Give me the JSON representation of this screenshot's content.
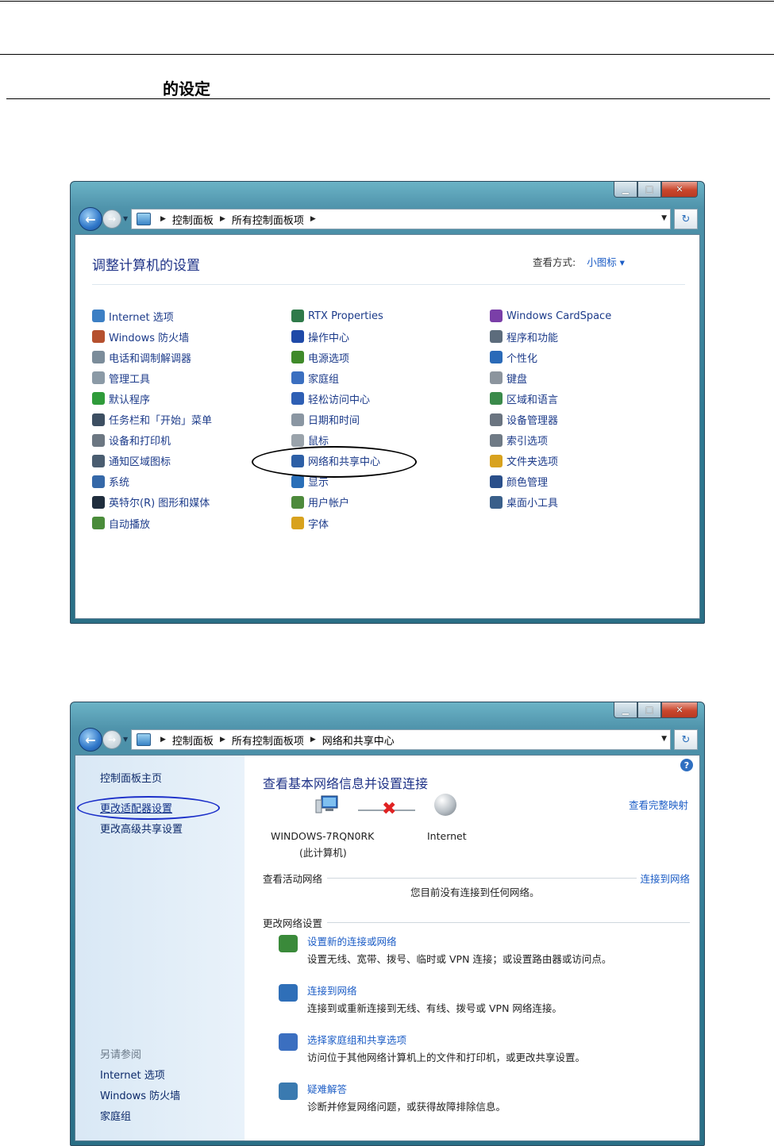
{
  "document": {
    "section_title": "的设定"
  },
  "window1": {
    "breadcrumb": [
      "控制面板",
      "所有控制面板项"
    ],
    "title": "调整计算机的设置",
    "view_by_label": "查看方式:",
    "view_by_value": "小图标 ▾",
    "columns": [
      [
        {
          "label": "Internet 选项",
          "icon": "internet-options-icon",
          "color": "#3c7fc4"
        },
        {
          "label": "Windows 防火墙",
          "icon": "firewall-icon",
          "color": "#b5502e"
        },
        {
          "label": "电话和调制解调器",
          "icon": "phone-modem-icon",
          "color": "#7b8c9a"
        },
        {
          "label": "管理工具",
          "icon": "admin-tools-icon",
          "color": "#8b9aa6"
        },
        {
          "label": "默认程序",
          "icon": "default-programs-icon",
          "color": "#2f9b3a"
        },
        {
          "label": "任务栏和「开始」菜单",
          "icon": "taskbar-icon",
          "color": "#3d4f62"
        },
        {
          "label": "设备和打印机",
          "icon": "printer-icon",
          "color": "#6c7782"
        },
        {
          "label": "通知区域图标",
          "icon": "notification-icon",
          "color": "#4a5d70"
        },
        {
          "label": "系统",
          "icon": "system-icon",
          "color": "#3568a8"
        },
        {
          "label": "英特尔(R) 图形和媒体",
          "icon": "intel-graphics-icon",
          "color": "#1f2d3d"
        },
        {
          "label": "自动播放",
          "icon": "autoplay-icon",
          "color": "#4a8c3a"
        }
      ],
      [
        {
          "label": "RTX Properties",
          "icon": "rtx-icon",
          "color": "#2f7a4a"
        },
        {
          "label": "操作中心",
          "icon": "action-center-icon",
          "color": "#1f4aa8"
        },
        {
          "label": "电源选项",
          "icon": "power-icon",
          "color": "#3f8a2a"
        },
        {
          "label": "家庭组",
          "icon": "homegroup-icon",
          "color": "#3b6fc0"
        },
        {
          "label": "轻松访问中心",
          "icon": "ease-access-icon",
          "color": "#2e5fb4"
        },
        {
          "label": "日期和时间",
          "icon": "datetime-icon",
          "color": "#8a96a2"
        },
        {
          "label": "鼠标",
          "icon": "mouse-icon",
          "color": "#9aa3ab"
        },
        {
          "label": "网络和共享中心",
          "icon": "network-center-icon",
          "color": "#2d5fa6"
        },
        {
          "label": "显示",
          "icon": "display-icon",
          "color": "#2a6fb8"
        },
        {
          "label": "用户帐户",
          "icon": "user-accounts-icon",
          "color": "#4d8a3c"
        },
        {
          "label": "字体",
          "icon": "fonts-icon",
          "color": "#d8a21e"
        }
      ],
      [
        {
          "label": "Windows CardSpace",
          "icon": "cardspace-icon",
          "color": "#7a3fa8"
        },
        {
          "label": "程序和功能",
          "icon": "programs-features-icon",
          "color": "#5c6c7c"
        },
        {
          "label": "个性化",
          "icon": "personalization-icon",
          "color": "#2a6ab8"
        },
        {
          "label": "键盘",
          "icon": "keyboard-icon",
          "color": "#8c959e"
        },
        {
          "label": "区域和语言",
          "icon": "region-icon",
          "color": "#3a8a4a"
        },
        {
          "label": "设备管理器",
          "icon": "device-manager-icon",
          "color": "#6a7480"
        },
        {
          "label": "索引选项",
          "icon": "indexing-icon",
          "color": "#6f7a85"
        },
        {
          "label": "文件夹选项",
          "icon": "folder-options-icon",
          "color": "#d8a21e"
        },
        {
          "label": "颜色管理",
          "icon": "color-management-icon",
          "color": "#2a4f8a"
        },
        {
          "label": "桌面小工具",
          "icon": "gadgets-icon",
          "color": "#3a5f8a"
        }
      ]
    ]
  },
  "window2": {
    "breadcrumb": [
      "控制面板",
      "所有控制面板项",
      "网络和共享中心"
    ],
    "sidebar": {
      "home": "控制面板主页",
      "adapter": "更改适配器设置",
      "advanced": "更改高级共享设置",
      "see_also": "另请参阅",
      "see_also_links": [
        "Internet 选项",
        "Windows 防火墙",
        "家庭组"
      ]
    },
    "title": "查看基本网络信息并设置连接",
    "full_map": "查看完整映射",
    "computer_name": "WINDOWS-7RQN0RK",
    "computer_sub": "(此计算机)",
    "internet": "Internet",
    "active_networks": "查看活动网络",
    "connect_to_network": "连接到网络",
    "no_network": "您目前没有连接到任何网络。",
    "change_settings": "更改网络设置",
    "tasks": [
      {
        "link": "设置新的连接或网络",
        "desc": "设置无线、宽带、拨号、临时或 VPN 连接；或设置路由器或访问点。",
        "icon": "new-connection-icon",
        "color": "#3a8a3a"
      },
      {
        "link": "连接到网络",
        "desc": "连接到或重新连接到无线、有线、拨号或 VPN 网络连接。",
        "icon": "connect-network-icon",
        "color": "#2f6fb8"
      },
      {
        "link": "选择家庭组和共享选项",
        "desc": "访问位于其他网络计算机上的文件和打印机，或更改共享设置。",
        "icon": "homegroup-sharing-icon",
        "color": "#3b6fc0"
      },
      {
        "link": "疑难解答",
        "desc": "诊断并修复网络问题，或获得故障排除信息。",
        "icon": "troubleshoot-icon",
        "color": "#3a7ab0"
      }
    ]
  }
}
